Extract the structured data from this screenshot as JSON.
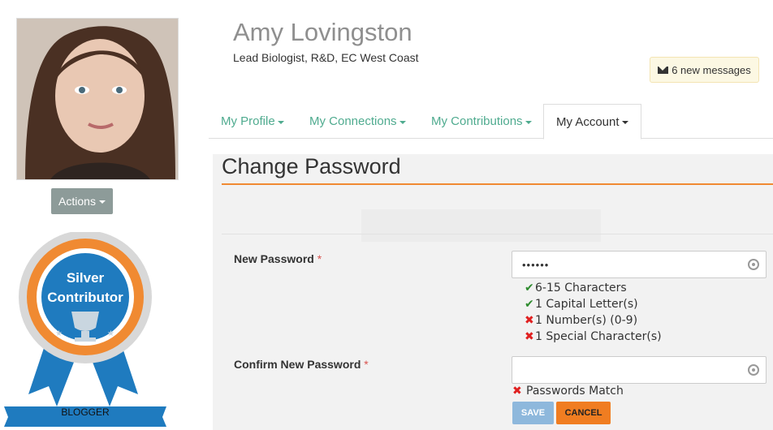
{
  "profile": {
    "name": "Amy Lovingston",
    "role": "Lead Biologist, R&D, EC West Coast",
    "actions_label": "Actions"
  },
  "badge": {
    "line1": "Silver",
    "line2": "Contributor",
    "ribbon": "BLOGGER"
  },
  "messages": {
    "label": "6 new messages",
    "icon": "envelope-icon"
  },
  "tabs": [
    {
      "label": "My Profile"
    },
    {
      "label": "My Connections"
    },
    {
      "label": "My Contributions"
    },
    {
      "label": "My Account"
    }
  ],
  "form": {
    "title": "Change Password",
    "new_password": {
      "label": "New Password",
      "required": "*",
      "value": "••••••"
    },
    "rules": [
      {
        "mark": "✔",
        "text": "6-15 Characters",
        "ok": true
      },
      {
        "mark": "✔",
        "text": "1 Capital Letter(s)",
        "ok": true
      },
      {
        "mark": "✖",
        "text": "1 Number(s) (0-9)",
        "ok": false
      },
      {
        "mark": "✖",
        "text": "1 Special Character(s)",
        "ok": false
      }
    ],
    "confirm_password": {
      "label": "Confirm New Password",
      "required": "*",
      "value": ""
    },
    "match": {
      "mark": "✖",
      "text": "Passwords Match"
    },
    "save_label": "SAVE",
    "cancel_label": "CANCEL"
  },
  "colors": {
    "accent_green": "#4fab8f",
    "title_rule": "#f08a32",
    "badge_blue": "#1f7bbf",
    "badge_orange": "#f08a32"
  }
}
